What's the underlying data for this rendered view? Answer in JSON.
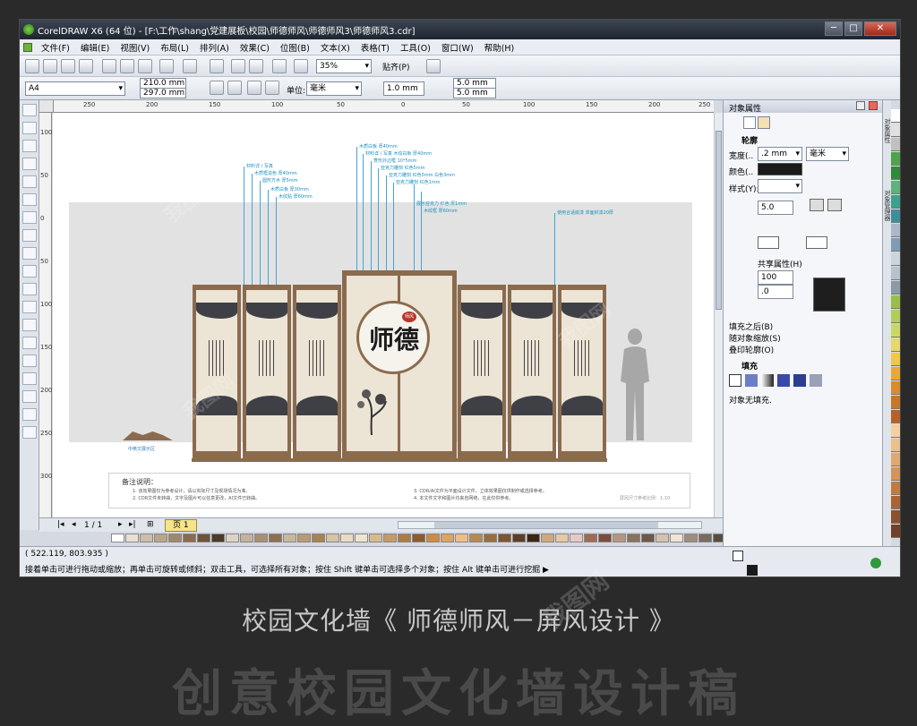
{
  "window": {
    "title": "CorelDRAW X6 (64 位) - [F:\\工作\\shang\\党建展板\\校园\\师德师风\\师德师风3\\师德师风3.cdr]",
    "buttons": [
      "─",
      "□",
      "✕"
    ]
  },
  "menu": [
    "文件(F)",
    "编辑(E)",
    "视图(V)",
    "布局(L)",
    "排列(A)",
    "效果(C)",
    "位图(B)",
    "文本(X)",
    "表格(T)",
    "工具(O)",
    "窗口(W)",
    "帮助(H)"
  ],
  "toolbar": {
    "zoom": "35%",
    "snap": "贴齐(P)"
  },
  "property_bar": {
    "page_size": "A4",
    "width": "210.0 mm",
    "height": "297.0 mm",
    "units_label": "单位:",
    "units": "毫米",
    "nudge": "1.0 mm",
    "dup_x": "5.0 mm",
    "dup_y": "5.0 mm"
  },
  "rulers": {
    "h_ticks": [
      "250",
      "200",
      "150",
      "100",
      "50",
      "0",
      "50",
      "100",
      "150",
      "200",
      "250"
    ],
    "v_ticks": [
      "100",
      "50",
      "0",
      "50",
      "100",
      "150",
      "200",
      "250",
      "300"
    ]
  },
  "design": {
    "seal": "师德",
    "seal_small": "师风",
    "left_base_caption": "中英文展示区",
    "notes_title": "备注说明：",
    "notes": [
      "1. 该效果图仅为参考设计，请以实际尺寸及现场情况为准。",
      "2. CDR文件未转曲，文字及图片可以任意更改，AI文件已转曲。",
      "3. CDR/AI文件为平面设计文件，立体效果图仅供制作或选择参考。",
      "4. 本文件文字和图片均来自网络，在此仅供参考。"
    ],
    "notes_right": "屏风尺寸参考比例：1:10",
    "annotations_left": [
      "材料详 / 写真",
      "木质框造色 厚40mm",
      "圆形方木 厚5mm",
      "木质白板 厚30mm",
      "木纹贴 厚60mm"
    ],
    "annotations_mid": [
      "木质白板 厚40mm",
      "材料详 / 写真 木纹白板 厚40mm",
      "菱形外边框 10*5mm",
      "亚克力雕刻 红色5mm",
      "亚克力雕刻 红色5mm 白色3mm",
      "亚克力雕刻 红色1mm"
    ],
    "annotations_mid2": [
      "展示亚克力 红色 厚1mm",
      "木纹框 厚60mm"
    ],
    "annotations_right": [
      "使用合适底漆 单面封漆20厚"
    ]
  },
  "page_nav": {
    "count": "1 / 1",
    "tab": "页 1"
  },
  "status": {
    "coords": "( 522.119, 803.935 )",
    "hint": "接着单击可进行拖动或缩放；再单击可旋转或倾斜；双击工具，可选择所有对象；按住 Shift 键单击可选择多个对象；按住 Alt 键单击可进行挖掘 ▶"
  },
  "docker": {
    "title": "对象属性",
    "outline_section": "轮廓",
    "width_label": "宽度(..",
    "width_value": ".2 mm",
    "width_unit": "毫米",
    "color_label": "颜色(..",
    "style_label": "样式(Y):",
    "miter": "5.0",
    "share_attr": "共享属性(H)",
    "stretch_value": "100",
    "angle_value": ".0",
    "checks": [
      "填充之后(B)",
      "随对象缩放(S)",
      "叠印轮廓(O)"
    ],
    "fill_section": "填充",
    "no_fill": "对象无填充.",
    "side_tabs": "对象属性",
    "side_tabs2": "对象管理器"
  },
  "colors": {
    "panel_wood": "#8b6b4e",
    "panel_cream": "#ece4d5",
    "ink_band": "#3f3f46",
    "leader_blue": "#43a5d8"
  },
  "watermark": "我图网",
  "caption": "校园文化墙《 师德师风－屏风设计 》",
  "bigtext": "创意校园文化墙设计稿"
}
